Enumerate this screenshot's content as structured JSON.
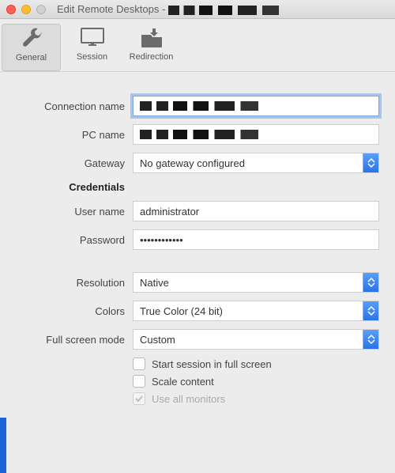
{
  "window": {
    "title_prefix": "Edit Remote Desktops - "
  },
  "toolbar": {
    "general": "General",
    "session": "Session",
    "redirection": "Redirection"
  },
  "labels": {
    "connection_name": "Connection name",
    "pc_name": "PC name",
    "gateway": "Gateway",
    "credentials": "Credentials",
    "user_name": "User name",
    "password": "Password",
    "resolution": "Resolution",
    "colors": "Colors",
    "full_screen_mode": "Full screen mode"
  },
  "values": {
    "gateway": "No gateway configured",
    "user_name": "administrator",
    "password": "••••••••••••",
    "resolution": "Native",
    "colors": "True Color (24 bit)",
    "full_screen_mode": "Custom"
  },
  "checks": {
    "start_full_screen": "Start session in full screen",
    "scale_content": "Scale content",
    "use_all_monitors": "Use all monitors"
  }
}
